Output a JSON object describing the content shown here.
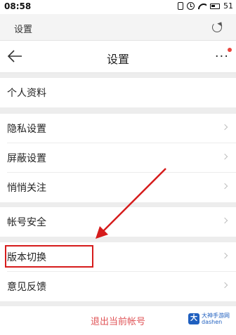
{
  "status_bar": {
    "time": "08:58",
    "battery": "51"
  },
  "browser_bar": {
    "title": "设置"
  },
  "nav_bar": {
    "title": "设置",
    "more": "···"
  },
  "groups": [
    {
      "items": [
        "个人资料"
      ]
    },
    {
      "items": [
        "隐私设置",
        "屏蔽设置",
        "悄悄关注"
      ]
    },
    {
      "items": [
        "帐号安全"
      ]
    },
    {
      "items": [
        "版本切换",
        "意见反馈"
      ]
    }
  ],
  "logout": {
    "label": "退出当前帐号"
  },
  "watermark": {
    "logo": "大",
    "line1": "大神手游网",
    "line2": "dashen"
  },
  "colors": {
    "annotation_red": "#d61c1c",
    "logout_red": "#e05558",
    "background": "#ededed"
  }
}
